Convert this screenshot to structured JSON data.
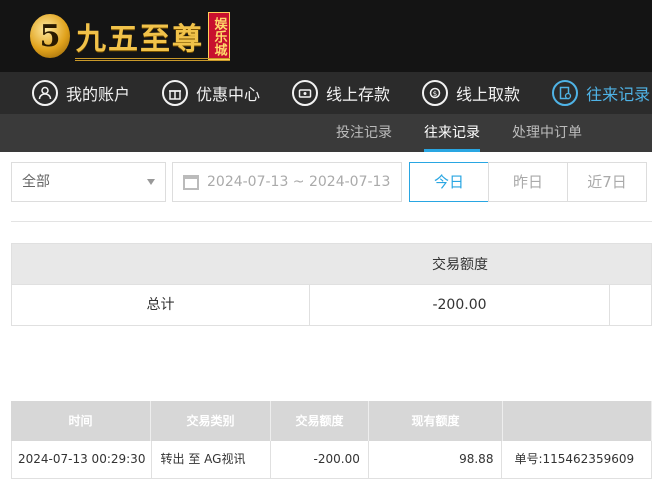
{
  "brand": {
    "mark": "5",
    "name": "九五至尊",
    "badge": "娱乐城"
  },
  "nav": [
    {
      "label": "我的账户",
      "icon": "user-icon",
      "active": false
    },
    {
      "label": "优惠中心",
      "icon": "gift-icon",
      "active": false
    },
    {
      "label": "线上存款",
      "icon": "deposit-icon",
      "active": false
    },
    {
      "label": "线上取款",
      "icon": "withdraw-icon",
      "active": false
    },
    {
      "label": "往来记录",
      "icon": "records-icon",
      "active": true
    }
  ],
  "subnav": [
    {
      "label": "投注记录",
      "active": false
    },
    {
      "label": "往来记录",
      "active": true
    },
    {
      "label": "处理中订单",
      "active": false
    }
  ],
  "filter": {
    "type_selected": "全部",
    "date_range": "2024-07-13 ~ 2024-07-13",
    "quick": [
      {
        "label": "今日",
        "active": true
      },
      {
        "label": "昨日",
        "active": false
      },
      {
        "label": "近7日",
        "active": false
      }
    ]
  },
  "summary": {
    "header": "交易额度",
    "row_label": "总计",
    "total": "-200.00"
  },
  "detail": {
    "columns": [
      "时间",
      "交易类别",
      "交易额度",
      "现有额度",
      ""
    ],
    "rows": [
      {
        "time": "2024-07-13 00:29:30",
        "type": "转出 至 AG视讯",
        "amount": "-200.00",
        "balance": "98.88",
        "order": "单号:115462359609"
      }
    ]
  },
  "colors": {
    "accent": "#29a6e2",
    "header_bg": "#141414",
    "nav_bg": "#2b2b2b",
    "subnav_bg": "#3a3a3a",
    "brand_gold": "#f1c24a"
  }
}
